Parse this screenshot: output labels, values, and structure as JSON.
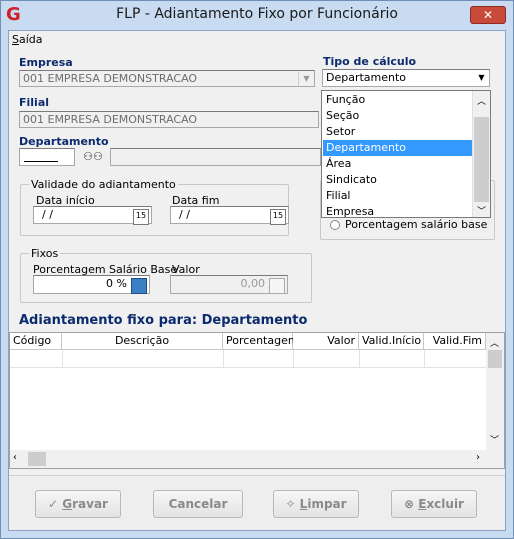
{
  "window": {
    "title": "FLP - Adiantamento Fixo por Funcionário",
    "close_label": "✕"
  },
  "menu": {
    "saida_first": "S",
    "saida_rest": "aída"
  },
  "empresa": {
    "label": "Empresa",
    "value": "001 EMPRESA DEMONSTRACAO"
  },
  "filial": {
    "label": "Filial",
    "value": "001 EMPRESA DEMONSTRACAO"
  },
  "departamento": {
    "label": "Departamento",
    "value": ""
  },
  "tipo_calculo": {
    "label": "Tipo de cálculo",
    "value": "Departamento",
    "options": [
      "Função",
      "Seção",
      "Setor",
      "Departamento",
      "Área",
      "Sindicato",
      "Filial",
      "Empresa"
    ],
    "selected_index": 3
  },
  "radio_percentual": {
    "label": "Porcentagem salário base"
  },
  "validade": {
    "title": "Validade do adiantamento",
    "inicio_label": "Data início",
    "inicio_value": "/ /",
    "fim_label": "Data fim",
    "fim_value": "/ /",
    "cal_icon": "15"
  },
  "fixos": {
    "title": "Fixos",
    "perc_label": "Porcentagem Salário Base",
    "perc_value": "0 %",
    "valor_label": "Valor",
    "valor_value": "0,00"
  },
  "section_title": "Adiantamento fixo para: Departamento",
  "table": {
    "columns": [
      "Código",
      "Descrição",
      "Porcentagem",
      "Valor",
      "Valid.Início",
      "Valid.Fim"
    ]
  },
  "buttons": {
    "gravar": {
      "u": "G",
      "rest": "ravar"
    },
    "cancelar": {
      "label": "Cancelar"
    },
    "limpar": {
      "u": "L",
      "rest": "impar"
    },
    "excluir": {
      "u": "E",
      "rest": "xcluir"
    }
  },
  "colors": {
    "accent": "#0c2a6e",
    "selection": "#3399ff",
    "titlebar": "#c9dbf1",
    "close": "#c74a3a"
  }
}
